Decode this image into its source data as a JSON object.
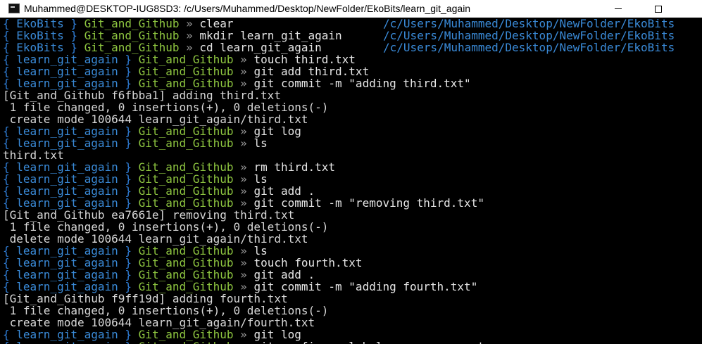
{
  "window": {
    "title": "Muhammed@DESKTOP-IUG8SD3: /c/Users/Muhammed/Desktop/NewFolder/EkoBits/learn_git_again"
  },
  "terminal": {
    "lines": [
      {
        "kind": "prompt",
        "dir": "EkoBits",
        "branch": "Git_and_Github",
        "cmd": "clear",
        "cwd": "/c/Users/Muhammed/Desktop/NewFolder/EkoBits"
      },
      {
        "kind": "prompt",
        "dir": "EkoBits",
        "branch": "Git_and_Github",
        "cmd": "mkdir learn_git_again",
        "cwd": "/c/Users/Muhammed/Desktop/NewFolder/EkoBits"
      },
      {
        "kind": "prompt",
        "dir": "EkoBits",
        "branch": "Git_and_Github",
        "cmd": "cd learn_git_again",
        "cwd": "/c/Users/Muhammed/Desktop/NewFolder/EkoBits"
      },
      {
        "kind": "prompt",
        "dir": "learn_git_again",
        "branch": "Git_and_Github",
        "cmd": "touch third.txt"
      },
      {
        "kind": "prompt",
        "dir": "learn_git_again",
        "branch": "Git_and_Github",
        "cmd": "git add third.txt"
      },
      {
        "kind": "prompt",
        "dir": "learn_git_again",
        "branch": "Git_and_Github",
        "cmd": "git commit -m \"adding third.txt\""
      },
      {
        "kind": "output",
        "text": "[Git_and_Github f6fbba1] adding third.txt"
      },
      {
        "kind": "output",
        "text": " 1 file changed, 0 insertions(+), 0 deletions(-)"
      },
      {
        "kind": "output",
        "text": " create mode 100644 learn_git_again/third.txt"
      },
      {
        "kind": "prompt",
        "dir": "learn_git_again",
        "branch": "Git_and_Github",
        "cmd": "git log"
      },
      {
        "kind": "prompt",
        "dir": "learn_git_again",
        "branch": "Git_and_Github",
        "cmd": "ls"
      },
      {
        "kind": "output",
        "text": "third.txt"
      },
      {
        "kind": "prompt",
        "dir": "learn_git_again",
        "branch": "Git_and_Github",
        "cmd": "rm third.txt"
      },
      {
        "kind": "prompt",
        "dir": "learn_git_again",
        "branch": "Git_and_Github",
        "cmd": "ls"
      },
      {
        "kind": "prompt",
        "dir": "learn_git_again",
        "branch": "Git_and_Github",
        "cmd": "git add ."
      },
      {
        "kind": "prompt",
        "dir": "learn_git_again",
        "branch": "Git_and_Github",
        "cmd": "git commit -m \"removing third.txt\""
      },
      {
        "kind": "output",
        "text": "[Git_and_Github ea7661e] removing third.txt"
      },
      {
        "kind": "output",
        "text": " 1 file changed, 0 insertions(+), 0 deletions(-)"
      },
      {
        "kind": "output",
        "text": " delete mode 100644 learn_git_again/third.txt"
      },
      {
        "kind": "prompt",
        "dir": "learn_git_again",
        "branch": "Git_and_Github",
        "cmd": "ls"
      },
      {
        "kind": "prompt",
        "dir": "learn_git_again",
        "branch": "Git_and_Github",
        "cmd": "touch fourth.txt"
      },
      {
        "kind": "prompt",
        "dir": "learn_git_again",
        "branch": "Git_and_Github",
        "cmd": "git add ."
      },
      {
        "kind": "prompt",
        "dir": "learn_git_again",
        "branch": "Git_and_Github",
        "cmd": "git commit -m \"adding fourth.txt\""
      },
      {
        "kind": "output",
        "text": "[Git_and_Github f9ff19d] adding fourth.txt"
      },
      {
        "kind": "output",
        "text": " 1 file changed, 0 insertions(+), 0 deletions(-)"
      },
      {
        "kind": "output",
        "text": " create mode 100644 learn_git_again/fourth.txt"
      },
      {
        "kind": "prompt",
        "dir": "learn_git_again",
        "branch": "Git_and_Github",
        "cmd": "git log"
      },
      {
        "kind": "prompt",
        "dir": "learn_git_again",
        "branch": "Git_and_Github",
        "cmd": "git config --global core.pager cat"
      }
    ],
    "colors": {
      "background": "#000000",
      "brace": "#2f7dd6",
      "directory": "#3a8bd9",
      "branch": "#8ec640",
      "arrow": "#9a9a9a",
      "command": "#e6e6e6",
      "output": "#d8d8d8"
    }
  }
}
